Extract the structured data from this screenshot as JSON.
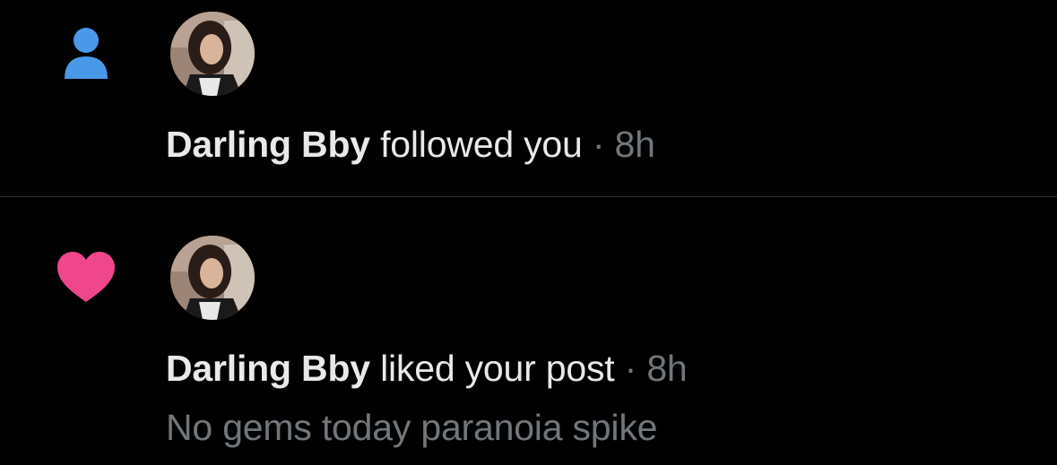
{
  "colors": {
    "background": "#000000",
    "follow_icon": "#4a99e9",
    "like_icon": "#f0468c",
    "primary_text": "#e7e9ea",
    "secondary_text": "#71767b",
    "divider": "#2f3336"
  },
  "notifications": [
    {
      "type_icon": "person-icon",
      "user_name": "Darling Bby",
      "action": "followed you",
      "separator": "·",
      "time": "8h"
    },
    {
      "type_icon": "heart-icon",
      "user_name": "Darling Bby",
      "action": "liked your post",
      "separator": "·",
      "time": "8h",
      "post_preview": "No gems today paranoia spike"
    }
  ]
}
